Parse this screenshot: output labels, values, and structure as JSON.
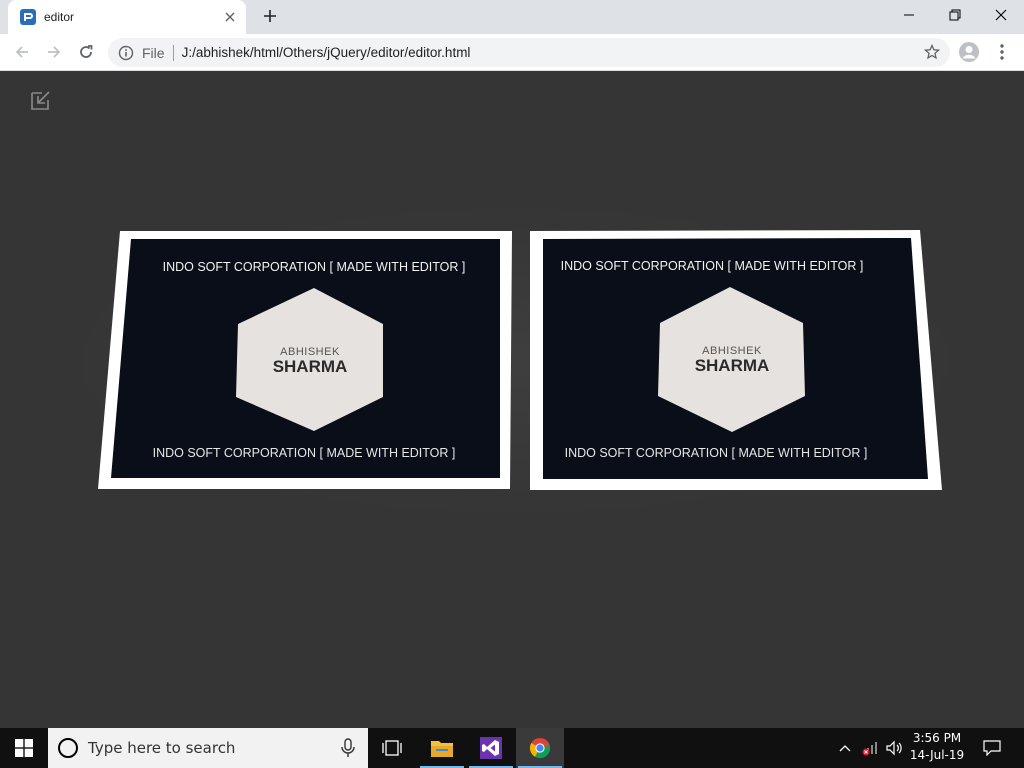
{
  "browser": {
    "tab": {
      "title": "editor"
    },
    "address": {
      "scheme": "File",
      "url": "J:/abhishek/html/Others/jQuery/editor/editor.html"
    }
  },
  "cards": [
    {
      "top_caption": "INDO SOFT CORPORATION [ MADE WITH EDITOR ]",
      "bottom_caption": "INDO SOFT CORPORATION [ MADE WITH EDITOR ]",
      "logo_line1": "ABHISHEK",
      "logo_line2": "SHARMA"
    },
    {
      "top_caption": "INDO SOFT CORPORATION [ MADE WITH EDITOR ]",
      "bottom_caption": "INDO SOFT CORPORATION [ MADE WITH EDITOR ]",
      "logo_line1": "ABHISHEK",
      "logo_line2": "SHARMA"
    }
  ],
  "taskbar": {
    "search_placeholder": "Type here to search",
    "time": "3:56 PM",
    "date": "14-Jul-19"
  },
  "colors": {
    "page_bg": "#353535",
    "card_frame": "#ffffff",
    "card_bg": "#0a0e18",
    "logo_hex": "#e6e2df",
    "taskbar": "#101010",
    "accent": "#76b9ed"
  },
  "icons": [
    "editor-favicon",
    "close-icon",
    "plus-icon",
    "minimize-icon",
    "restore-icon",
    "back-arrow-icon",
    "forward-arrow-icon",
    "reload-icon",
    "info-icon",
    "star-icon",
    "profile-icon",
    "menu-dots-icon",
    "exit-fullscreen-icon",
    "windows-logo-icon",
    "search-icon",
    "microphone-icon",
    "task-view-icon",
    "file-explorer-icon",
    "visual-studio-icon",
    "chrome-icon",
    "chevron-up-icon",
    "network-icon",
    "volume-icon",
    "notifications-icon"
  ]
}
